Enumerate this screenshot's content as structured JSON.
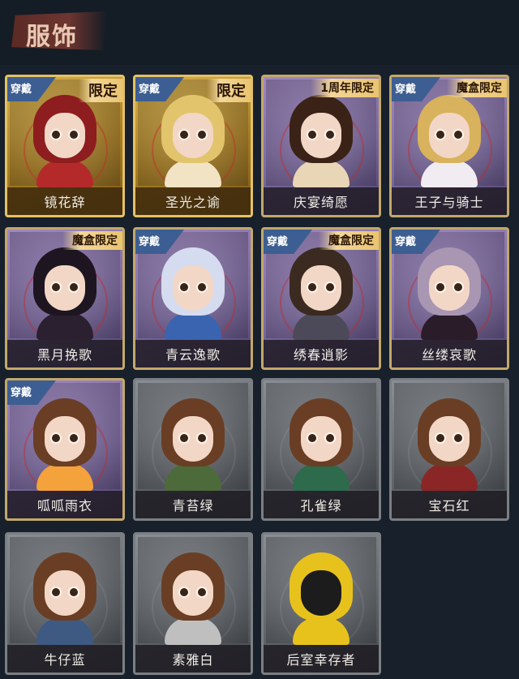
{
  "header": {
    "title": "服饰"
  },
  "costumes": [
    {
      "name": "镜花辞",
      "worn_badge": "穿戴",
      "tag": "限定",
      "frame": "gold",
      "hair": "#8e1d1f",
      "outfit": "#b42a2a"
    },
    {
      "name": "圣光之谕",
      "worn_badge": "穿戴",
      "tag": "限定",
      "frame": "gold",
      "hair": "#e2c46c",
      "outfit": "#f1e3c4"
    },
    {
      "name": "庆宴绮愿",
      "worn_badge": "",
      "tag": "1周年限定",
      "frame": "purple",
      "hair": "#3a2216",
      "outfit": "#e9d6b6"
    },
    {
      "name": "王子与骑士",
      "worn_badge": "穿戴",
      "tag": "魔盒限定",
      "frame": "purple",
      "hair": "#d8b25c",
      "outfit": "#f0ecf2"
    },
    {
      "name": "黑月挽歌",
      "worn_badge": "",
      "tag": "魔盒限定",
      "frame": "purple",
      "hair": "#1d1620",
      "outfit": "#2a2030"
    },
    {
      "name": "青云逸歌",
      "worn_badge": "穿戴",
      "tag": "",
      "frame": "purple",
      "hair": "#d6dcef",
      "outfit": "#3a64b0"
    },
    {
      "name": "绣春逍影",
      "worn_badge": "穿戴",
      "tag": "魔盒限定",
      "frame": "purple",
      "hair": "#3b2a20",
      "outfit": "#4c4a58"
    },
    {
      "name": "丝缕哀歌",
      "worn_badge": "穿戴",
      "tag": "",
      "frame": "purple",
      "hair": "#a896b2",
      "outfit": "#2a1c28"
    },
    {
      "name": "呱呱雨衣",
      "worn_badge": "穿戴",
      "tag": "",
      "frame": "purple",
      "hair": "#6a3e24",
      "outfit": "#f3a23c"
    },
    {
      "name": "青苔绿",
      "worn_badge": "",
      "tag": "",
      "frame": "gray",
      "hair": "#6a3e24",
      "outfit": "#4c6a3a"
    },
    {
      "name": "孔雀绿",
      "worn_badge": "",
      "tag": "",
      "frame": "gray",
      "hair": "#6a3e24",
      "outfit": "#2e6a4c"
    },
    {
      "name": "宝石红",
      "worn_badge": "",
      "tag": "",
      "frame": "gray",
      "hair": "#6a3e24",
      "outfit": "#8a2626"
    },
    {
      "name": "牛仔蓝",
      "worn_badge": "",
      "tag": "",
      "frame": "gray",
      "hair": "#6a3e24",
      "outfit": "#3e5a82"
    },
    {
      "name": "素雅白",
      "worn_badge": "",
      "tag": "",
      "frame": "gray",
      "hair": "#6a3e24",
      "outfit": "#bfbfbf"
    },
    {
      "name": "后室幸存者",
      "worn_badge": "",
      "tag": "",
      "frame": "gray",
      "hair": "#e8c21c",
      "outfit": "#e8c21c"
    }
  ]
}
